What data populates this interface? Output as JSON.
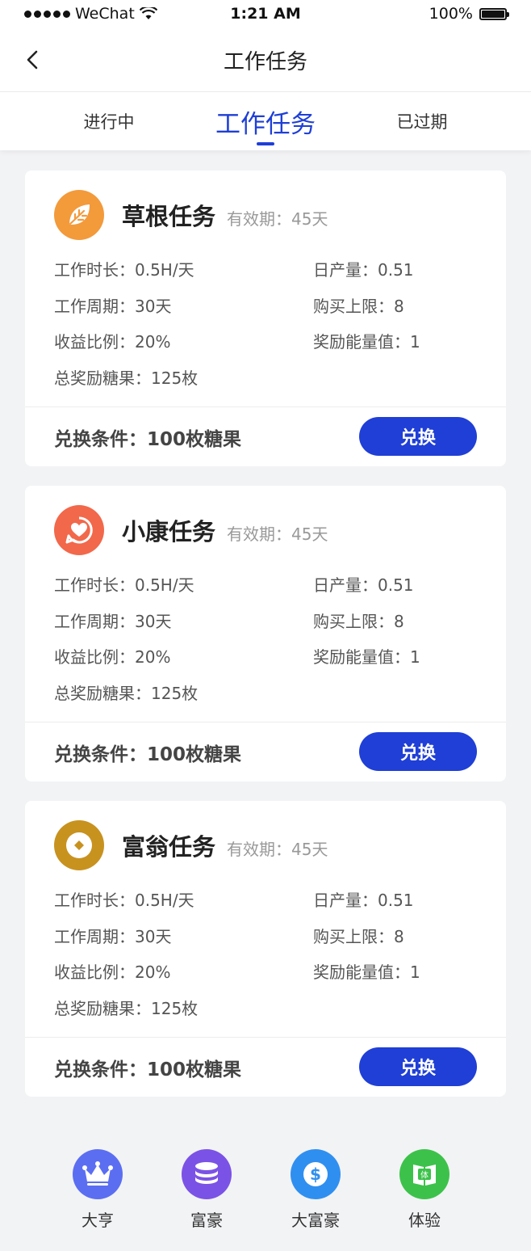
{
  "status": {
    "carrier": "WeChat",
    "time": "1:21 AM",
    "battery": "100%"
  },
  "nav": {
    "title": "工作任务"
  },
  "tabs": [
    {
      "label": "进行中",
      "active": false
    },
    {
      "label": "工作任务",
      "active": true
    },
    {
      "label": "已过期",
      "active": false
    }
  ],
  "cards": [
    {
      "name": "草根任务",
      "validity": "有效期：45天",
      "icon": "leaf-icon",
      "icon_color": "#f39a3b",
      "duration": "工作时长：0.5H/天",
      "daily_output": "日产量：0.51",
      "cycle": "工作周期：30天",
      "purchase_limit": "购买上限：8",
      "yield_ratio": "收益比例：20%",
      "energy_reward": "奖励能量值：1",
      "total_reward": "总奖励糖果：125枚",
      "condition": "兑换条件：100枚糖果",
      "button": "兑换"
    },
    {
      "name": "小康任务",
      "validity": "有效期：45天",
      "icon": "heart-chat-icon",
      "icon_color": "#f2684a",
      "duration": "工作时长：0.5H/天",
      "daily_output": "日产量：0.51",
      "cycle": "工作周期：30天",
      "purchase_limit": "购买上限：8",
      "yield_ratio": "收益比例：20%",
      "energy_reward": "奖励能量值：1",
      "total_reward": "总奖励糖果：125枚",
      "condition": "兑换条件：100枚糖果",
      "button": "兑换"
    },
    {
      "name": "富翁任务",
      "validity": "有效期：45天",
      "icon": "coin-icon",
      "icon_color": "#c8921f",
      "duration": "工作时长：0.5H/天",
      "daily_output": "日产量：0.51",
      "cycle": "工作周期：30天",
      "purchase_limit": "购买上限：8",
      "yield_ratio": "收益比例：20%",
      "energy_reward": "奖励能量值：1",
      "total_reward": "总奖励糖果：125枚",
      "condition": "兑换条件：100枚糖果",
      "button": "兑换"
    }
  ],
  "bottom_nav": [
    {
      "label": "大亨",
      "icon": "crown-icon",
      "color": "#5b6ef2"
    },
    {
      "label": "富豪",
      "icon": "coin-stack-icon",
      "color": "#7b52e6"
    },
    {
      "label": "大富豪",
      "icon": "dollar-icon",
      "color": "#2f8ff0"
    },
    {
      "label": "体验",
      "icon": "book-icon",
      "color": "#3cc24a",
      "icon_text": "体"
    }
  ]
}
